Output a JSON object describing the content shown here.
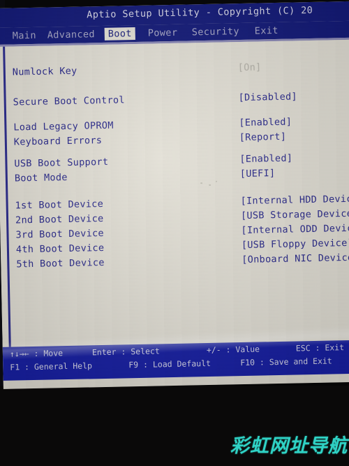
{
  "screen": {
    "title": "Aptio Setup Utility - Copyright (C) 20",
    "tabs": [
      {
        "label": "Main",
        "active": false
      },
      {
        "label": "Advanced",
        "active": false
      },
      {
        "label": "Boot",
        "active": true
      },
      {
        "label": "Power",
        "active": false
      },
      {
        "label": "Security",
        "active": false
      },
      {
        "label": "Exit",
        "active": false
      }
    ],
    "settings": [
      {
        "label": "Numlock Key",
        "value": "[On]",
        "highlighted": true
      },
      {
        "label": "Secure Boot Control",
        "value": "[Disabled]",
        "highlighted": false
      },
      {
        "label": "Load Legacy OPROM",
        "value": "[Enabled]",
        "highlighted": false
      },
      {
        "label": "Keyboard Errors",
        "value": "[Report]",
        "highlighted": false
      },
      {
        "label": "USB Boot Support",
        "value": "[Enabled]",
        "highlighted": false
      },
      {
        "label": "Boot Mode",
        "value": "[UEFI]",
        "highlighted": false
      },
      {
        "label": "1st Boot Device",
        "value": "[Internal HDD Device]",
        "highlighted": false
      },
      {
        "label": "2nd Boot Device",
        "value": "[USB Storage Device]",
        "highlighted": false
      },
      {
        "label": "3rd Boot Device",
        "value": "[Internal ODD Device]",
        "highlighted": false
      },
      {
        "label": "4th Boot Device",
        "value": "[USB Floppy Device]",
        "highlighted": false
      },
      {
        "label": "5th Boot Device",
        "value": "[Onboard NIC Device]",
        "highlighted": false
      }
    ],
    "legend": [
      {
        "key": "↑↓→←",
        "action": "Move"
      },
      {
        "key": "Enter",
        "action": "Select"
      },
      {
        "key": "+/-",
        "action": "Value"
      },
      {
        "key": "ESC",
        "action": "Exit"
      },
      {
        "key": "F1",
        "action": "General Help"
      },
      {
        "key": "F9",
        "action": "Load Default"
      },
      {
        "key": "F10",
        "action": "Save and Exit"
      }
    ],
    "colors": {
      "title_bar": "#131a7a",
      "menu_bar": "#131a7a",
      "active_tab_bg": "#e6e3d8",
      "active_tab_text": "#1b1f7e",
      "content_bg": "#e4e1d7",
      "text": "#2a2a8d",
      "legend_bg": "#1820a4",
      "frame_line": "#2b2b8f"
    }
  },
  "watermark": {
    "text": "彩虹网址导航",
    "color": "#2fd3c6"
  }
}
